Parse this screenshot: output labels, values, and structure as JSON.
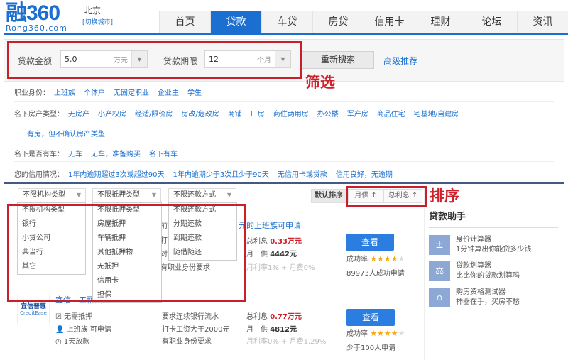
{
  "header": {
    "logo_main": "融360",
    "logo_sub": "Rong360.com",
    "city": "北京",
    "switch_city": "[切换城市]",
    "nav": [
      {
        "label": "首页"
      },
      {
        "label": "贷款",
        "active": true
      },
      {
        "label": "车贷"
      },
      {
        "label": "房贷"
      },
      {
        "label": "信用卡"
      },
      {
        "label": "理财"
      },
      {
        "label": "论坛"
      },
      {
        "label": "资讯"
      }
    ]
  },
  "search": {
    "amount_label": "贷款金额",
    "amount_value": "5.0",
    "amount_unit": "万元",
    "term_label": "贷款期限",
    "term_value": "12",
    "term_unit": "个月",
    "research_button": "重新搜索",
    "advanced_link": "高级推荐"
  },
  "annotations": {
    "filter": "筛选",
    "sort": "排序"
  },
  "filters": {
    "occupation": {
      "label": "职业身份：",
      "options": [
        "上班族",
        "个体户",
        "无固定职业",
        "企业主",
        "学生"
      ]
    },
    "property": {
      "label": "名下房产类型：",
      "options": [
        "无房产",
        "小产权房",
        "经适/限价房",
        "房改/危改房",
        "商铺",
        "厂房",
        "商住两用房",
        "办公楼",
        "军产房",
        "商品住宅",
        "宅基地/自建房"
      ],
      "extra": "有房，但不确认房产类型"
    },
    "car": {
      "label": "名下是否有车：",
      "options": [
        "无车",
        "无车，准备购买",
        "名下有车"
      ]
    },
    "credit": {
      "label": "您的信用情况：",
      "options": [
        "1年内逾期超过3次或超过90天",
        "1年内逾期少于3次且少于90天",
        "无信用卡或贷款",
        "信用良好，无逾期"
      ]
    }
  },
  "dropdowns": [
    {
      "selected": "不限机构类型",
      "options": [
        "不限机构类型",
        "银行",
        "小贷公司",
        "典当行",
        "其它"
      ]
    },
    {
      "selected": "不限抵押类型",
      "options": [
        "不限抵押类型",
        "房屋抵押",
        "车辆抵押",
        "其他抵押物",
        "无抵押",
        "信用卡",
        "担保"
      ]
    },
    {
      "selected": "不限还款方式",
      "options": [
        "不限还款方式",
        "分期还款",
        "到期还款",
        "随借随还"
      ]
    }
  ],
  "sort": {
    "default": "默认排序",
    "monthly": "月供",
    "interest": "总利息",
    "arrow": "↑"
  },
  "products": [
    {
      "title_fragment": "元的上班族可申请",
      "left_fragments": [
        "前",
        "打",
        "对"
      ],
      "req3": "有职业身份要求",
      "interest_label": "总利息",
      "interest": "0.33万元",
      "monthly_label": "月　供",
      "monthly": "4442元",
      "rate": "月利率1% + 月费0%",
      "view": "查看",
      "success_label": "成功率",
      "stars": 4,
      "applicants": "89973人成功申请"
    },
    {
      "logo_main": "宜信普惠",
      "logo_sub": "CreditEase",
      "title": "宜信　工薪贷",
      "attrs": [
        "无需抵押",
        "上班族 可申请",
        "1天放款"
      ],
      "reqs": [
        "要求连续银行流水",
        "打卡工资大于2000元",
        "有职业身份要求"
      ],
      "interest_label": "总利息",
      "interest": "0.77万元",
      "monthly_label": "月　供",
      "monthly": "4812元",
      "rate": "月利率0% + 月费1.29%",
      "view": "查看",
      "success_label": "成功率",
      "stars": 4,
      "applicants": "少于100人申请"
    }
  ],
  "sidebar": {
    "title": "贷款助手",
    "items": [
      {
        "icon": "calculator-icon",
        "title": "身价计算器",
        "desc": "1分钟算出你能贷多少钱"
      },
      {
        "icon": "scale-icon",
        "title": "贷款划算器",
        "desc": "比比你的贷款划算吗"
      },
      {
        "icon": "house-icon",
        "title": "购房资格测试器",
        "desc": "神器在手，买房不愁"
      }
    ]
  }
}
